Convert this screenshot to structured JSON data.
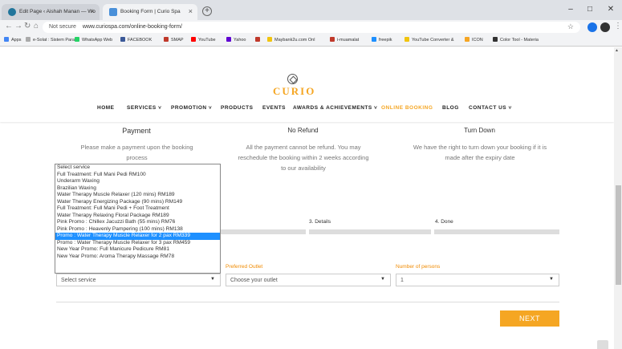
{
  "browser": {
    "tabs": [
      {
        "label": "Edit Page ‹ Aishah Manan — Wo"
      },
      {
        "label": "Booking Form | Curio Spa"
      }
    ],
    "url_prefix": "Not secure",
    "url": "www.curiospa.com/online-booking-form/"
  },
  "bookmarks": [
    {
      "label": "Apps",
      "color": "#4285f4"
    },
    {
      "label": "e-Solat : Sistem Paras",
      "color": "#aaaaaa"
    },
    {
      "label": "WhatsApp Web",
      "color": "#25d366"
    },
    {
      "label": "FACEBOOK",
      "color": "#3b5998"
    },
    {
      "label": "SMAP",
      "color": "#c0392b"
    },
    {
      "label": "YouTube",
      "color": "#ff0000"
    },
    {
      "label": "Yahoo",
      "color": "#6001d2"
    },
    {
      "label": "",
      "color": "#c0392b"
    },
    {
      "label": "Maybank2u.com Onl",
      "color": "#f1c40f"
    },
    {
      "label": "i-muamalat",
      "color": "#c0392b"
    },
    {
      "label": "freepik",
      "color": "#1e90ff"
    },
    {
      "label": "YouTube Converter &",
      "color": "#f1c40f"
    },
    {
      "label": "ICON",
      "color": "#f5a623"
    },
    {
      "label": "Color Tool - Materia",
      "color": "#333333"
    }
  ],
  "site": {
    "logo": "CURIO",
    "nav": [
      "HOME",
      "SERVICES",
      "PROMOTION",
      "PRODUCTS",
      "EVENTS",
      "AWARDS & ACHIEVEMENTS",
      "ONLINE BOOKING",
      "BLOG",
      "CONTACT US"
    ]
  },
  "info": [
    {
      "title": "Payment",
      "text": "Please make a payment upon the booking process"
    },
    {
      "title": "No Refund",
      "text": "All the payment cannot be refund. You may reschedule the booking within 2 weeks according to our availability"
    },
    {
      "title": "Turn Down",
      "text": "We have the right to turn down your booking if it is made after the expiry date"
    }
  ],
  "steps": {
    "step3": "3. Details",
    "step4": "4. Done"
  },
  "form": {
    "service_select": "Select service",
    "outlet_label": "Preferred Outlet",
    "outlet_select": "Choose your outlet",
    "persons_label": "Number of persons",
    "persons_select": "1"
  },
  "service_options": [
    "Select service",
    "Full Treatment: Full Mani Pedi RM100",
    "Underarm Waxing",
    "Brazilian Waxing",
    "Water Therapy Muscle Relaxer (120 mins) RM189",
    "Water Therapy Energizing Package (90 mins) RM149",
    "Full Treatment: Full Mani Pedi + Foot Treatment",
    "Water Therapy Relaxing Floral Package RM189",
    "Pink Promo : Chillex Jacuzzi Bath (55 mins) RM76",
    "Pink Promo : Heavenly Pampering (100 mins) RM138",
    "Promo : Water Therapy Muscle Relaxer for 2 pax RM339",
    "Promo : Water Therapy Muscle Relaxer for 3 pax RM459",
    "New Year Promo: Full Manicure Pedicure RM81",
    "New Year Promo: Aroma Therapy Massage RM78"
  ],
  "selected_option_index": 10,
  "next_label": "NEXT",
  "colors": {
    "accent": "#f5a623",
    "selection": "#1e90ff"
  }
}
